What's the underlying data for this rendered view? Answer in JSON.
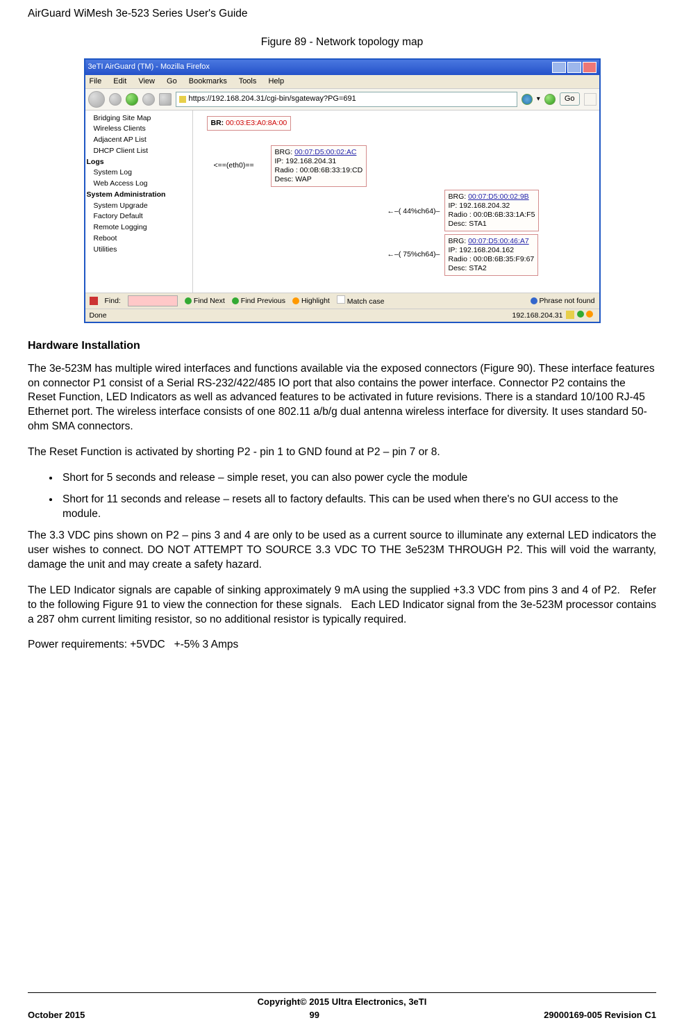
{
  "header": "AirGuard WiMesh 3e-523 Series User's Guide",
  "figcaption": "Figure 89 - Network topology map",
  "ss": {
    "title": "3eTI AirGuard (TM) - Mozilla Firefox",
    "menu": {
      "m1": "File",
      "m2": "Edit",
      "m3": "View",
      "m4": "Go",
      "m5": "Bookmarks",
      "m6": "Tools",
      "m7": "Help"
    },
    "url": "https://192.168.204.31/cgi-bin/sgateway?PG=691",
    "go": "Go",
    "side": {
      "g1": "Bridging Site Map",
      "g2": "Wireless Clients",
      "g3": "Adjacent AP List",
      "g4": "DHCP Client List",
      "logs": "Logs",
      "l1": "System Log",
      "l2": "Web Access Log",
      "sa": "System Administration",
      "s1": "System Upgrade",
      "s2": "Factory Default",
      "s3": "Remote Logging",
      "s4": "Reboot",
      "s5": "Utilities"
    },
    "top": {
      "label": "BR:",
      "mac": "00:03:E3:A0:8A:00"
    },
    "eth": "<==(eth0)==",
    "box1": {
      "l1a": "BRG: ",
      "l1b": "00:07:D5:00:02:AC",
      "l2": "IP:  192.168.204.31",
      "l3": "Radio : 00:0B:6B:33:19:CD",
      "l4": "Desc: WAP"
    },
    "a1": "←–( 44%ch64)–",
    "box2": {
      "l1a": "BRG: ",
      "l1b": "00:07:D5:00:02:9B",
      "l2": "IP:  192.168.204.32",
      "l3": "Radio : 00:0B:6B:33:1A:F5",
      "l4": "Desc: STA1"
    },
    "a2": "←–( 75%ch64)–",
    "box3": {
      "l1a": "BRG: ",
      "l1b": "00:07:D5:00:46:A7",
      "l2": "IP:  192.168.204.162",
      "l3": "Radio : 00:0B:6B:35:F9:67",
      "l4": "Desc: STA2"
    },
    "find": {
      "label": "Find:",
      "n": "Find Next",
      "p": "Find Previous",
      "h": "Highlight",
      "m": "Match case",
      "nf": "Phrase not found"
    },
    "status": {
      "done": "Done",
      "ip": "192.168.204.31"
    }
  },
  "section": "Hardware Installation",
  "p1": "The 3e-523M has multiple wired interfaces and functions available via the exposed connectors (Figure 90). These interface features on connector P1 consist of a Serial RS-232/422/485 IO port that also contains the power interface. Connector P2 contains the Reset Function, LED Indicators as well as advanced features to be activated in future revisions. There is a standard 10/100 RJ-45 Ethernet port. The wireless interface consists of one 802.11 a/b/g dual antenna wireless interface for diversity. It uses standard 50-ohm SMA connectors.",
  "p2": "The Reset Function is activated by shorting P2 - pin 1 to GND found at P2 – pin 7 or 8.",
  "b1": "Short for 5 seconds and release – simple reset, you can also power cycle the module",
  "b2": "Short for 11 seconds and release – resets all to factory defaults. This can be used when there's no GUI access to the module.",
  "p3": "The 3.3 VDC pins shown on P2 – pins 3 and 4 are only to be used as a current source to illuminate any external LED indicators the user wishes to connect. DO NOT ATTEMPT TO SOURCE 3.3 VDC TO THE 3e523M THROUGH P2. This will void the warranty, damage the unit and may create a safety hazard.",
  "p4": "The LED Indicator signals are capable of sinking approximately 9 mA using the supplied +3.3 VDC from pins 3 and 4 of P2.   Refer to the following Figure 91 to view the connection for these signals.   Each LED Indicator signal from the 3e-523M processor contains a 287 ohm current limiting resistor, so no additional resistor is typically required.",
  "p5": "Power requirements: +5VDC   +-5% 3 Amps",
  "footer": {
    "copyright": "Copyright© 2015 Ultra Electronics, 3eTI",
    "left": "October 2015",
    "center": "99",
    "right": "29000169-005 Revision C1"
  }
}
